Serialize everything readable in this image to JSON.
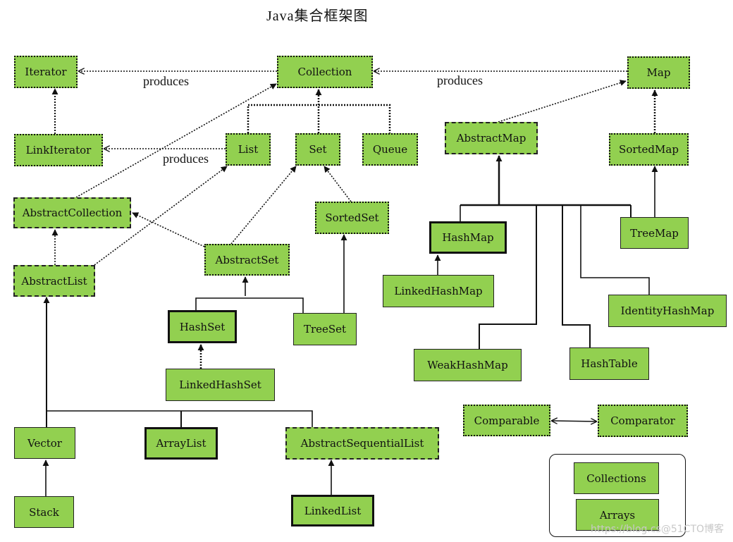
{
  "title": "Java集合框架图",
  "edge_labels": {
    "iterator_produces": "produces",
    "map_produces": "produces",
    "list_produces": "produces"
  },
  "nodes": {
    "iterator": {
      "label": "Iterator",
      "kind": "interface"
    },
    "collection": {
      "label": "Collection",
      "kind": "interface"
    },
    "map": {
      "label": "Map",
      "kind": "interface"
    },
    "linkiterator": {
      "label": "LinkIterator",
      "kind": "interface"
    },
    "list": {
      "label": "List",
      "kind": "interface"
    },
    "set": {
      "label": "Set",
      "kind": "interface"
    },
    "queue": {
      "label": "Queue",
      "kind": "interface"
    },
    "abstractmap": {
      "label": "AbstractMap",
      "kind": "abstract"
    },
    "sortedmap": {
      "label": "SortedMap",
      "kind": "interface"
    },
    "abstractcollection": {
      "label": "AbstractCollection",
      "kind": "abstract"
    },
    "sortedset": {
      "label": "SortedSet",
      "kind": "interface"
    },
    "hashmap": {
      "label": "HashMap",
      "kind": "common-class"
    },
    "treemap": {
      "label": "TreeMap",
      "kind": "class"
    },
    "abstractset": {
      "label": "AbstractSet",
      "kind": "interface"
    },
    "abstractlist": {
      "label": "AbstractList",
      "kind": "abstract"
    },
    "linkedhashmap": {
      "label": "LinkedHashMap",
      "kind": "class"
    },
    "identityhashmap": {
      "label": "IdentityHashMap",
      "kind": "class"
    },
    "hashset": {
      "label": "HashSet",
      "kind": "common-class"
    },
    "treeset": {
      "label": "TreeSet",
      "kind": "class"
    },
    "weakhashmap": {
      "label": "WeakHashMap",
      "kind": "class"
    },
    "hashtable": {
      "label": "HashTable",
      "kind": "class"
    },
    "linkedhashset": {
      "label": "LinkedHashSet",
      "kind": "class"
    },
    "comparable": {
      "label": "Comparable",
      "kind": "interface"
    },
    "comparator": {
      "label": "Comparator",
      "kind": "interface"
    },
    "vector": {
      "label": "Vector",
      "kind": "class"
    },
    "arraylist": {
      "label": "ArrayList",
      "kind": "common-class"
    },
    "abstractsequentiallist": {
      "label": "AbstractSequentialList",
      "kind": "abstract"
    },
    "collections": {
      "label": "Collections",
      "kind": "utility"
    },
    "stack": {
      "label": "Stack",
      "kind": "class"
    },
    "linkedlist": {
      "label": "LinkedList",
      "kind": "common-class"
    },
    "arrays": {
      "label": "Arrays",
      "kind": "utility"
    }
  },
  "relations": [
    {
      "from": "collection",
      "to": "iterator",
      "type": "produces"
    },
    {
      "from": "map",
      "to": "collection",
      "type": "produces"
    },
    {
      "from": "list",
      "to": "linkiterator",
      "type": "produces"
    },
    {
      "from": "linkiterator",
      "to": "iterator",
      "type": "implements"
    },
    {
      "from": "list",
      "to": "collection",
      "type": "implements"
    },
    {
      "from": "set",
      "to": "collection",
      "type": "implements"
    },
    {
      "from": "queue",
      "to": "collection",
      "type": "implements"
    },
    {
      "from": "abstractcollection",
      "to": "collection",
      "type": "implements"
    },
    {
      "from": "abstractlist",
      "to": "abstractcollection",
      "type": "implements"
    },
    {
      "from": "abstractlist",
      "to": "list",
      "type": "implements"
    },
    {
      "from": "abstractset",
      "to": "abstractcollection",
      "type": "implements"
    },
    {
      "from": "abstractset",
      "to": "set",
      "type": "implements"
    },
    {
      "from": "sortedset",
      "to": "set",
      "type": "implements"
    },
    {
      "from": "hashset",
      "to": "abstractset",
      "type": "extends"
    },
    {
      "from": "treeset",
      "to": "abstractset",
      "type": "extends"
    },
    {
      "from": "treeset",
      "to": "sortedset",
      "type": "implements"
    },
    {
      "from": "linkedhashset",
      "to": "hashset",
      "type": "extends"
    },
    {
      "from": "vector",
      "to": "abstractlist",
      "type": "extends"
    },
    {
      "from": "arraylist",
      "to": "abstractlist",
      "type": "extends"
    },
    {
      "from": "abstractsequentiallist",
      "to": "abstractlist",
      "type": "extends"
    },
    {
      "from": "stack",
      "to": "vector",
      "type": "extends"
    },
    {
      "from": "linkedlist",
      "to": "abstractsequentiallist",
      "type": "extends"
    },
    {
      "from": "abstractmap",
      "to": "map",
      "type": "implements"
    },
    {
      "from": "sortedmap",
      "to": "map",
      "type": "implements"
    },
    {
      "from": "hashmap",
      "to": "abstractmap",
      "type": "extends"
    },
    {
      "from": "treemap",
      "to": "abstractmap",
      "type": "extends"
    },
    {
      "from": "treemap",
      "to": "sortedmap",
      "type": "implements"
    },
    {
      "from": "weakhashmap",
      "to": "abstractmap",
      "type": "extends"
    },
    {
      "from": "hashtable",
      "to": "abstractmap",
      "type": "extends"
    },
    {
      "from": "identityhashmap",
      "to": "abstractmap",
      "type": "extends"
    },
    {
      "from": "linkedhashmap",
      "to": "hashmap",
      "type": "extends"
    },
    {
      "from": "comparable",
      "to": "comparator",
      "type": "related"
    }
  ],
  "watermark": "https://blog.cs@51CTO博客"
}
